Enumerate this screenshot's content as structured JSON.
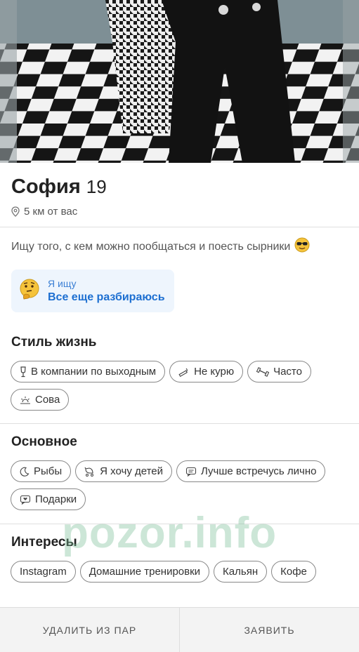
{
  "profile": {
    "name": "София",
    "age": "19",
    "distance": "5 км от вас",
    "bio": "Ищу того, с кем можно пообщаться и поесть сырники"
  },
  "seeking": {
    "label": "Я ищу",
    "value": "Все еще разбираюсь"
  },
  "lifestyle": {
    "title": "Стиль жизнь",
    "chips": [
      {
        "label": "В компании по выходным",
        "icon": "glass-icon"
      },
      {
        "label": "Не курю",
        "icon": "no-smoking-icon"
      },
      {
        "label": "Часто",
        "icon": "dumbbell-icon"
      },
      {
        "label": "Сова",
        "icon": "sunset-icon"
      }
    ]
  },
  "basics": {
    "title": "Основное",
    "chips": [
      {
        "label": "Рыбы",
        "icon": "moon-icon"
      },
      {
        "label": "Я хочу детей",
        "icon": "stroller-icon"
      },
      {
        "label": "Лучше встречусь лично",
        "icon": "chat-icon"
      },
      {
        "label": "Подарки",
        "icon": "gift-message-icon"
      }
    ]
  },
  "interests": {
    "title": "Интересы",
    "chips": [
      "Instagram",
      "Домашние тренировки",
      "Кальян",
      "Кофе"
    ]
  },
  "watermark": "pozor.info",
  "actions": {
    "remove": "УДАЛИТЬ ИЗ ПАР",
    "report": "ЗАЯВИТЬ"
  },
  "colors": {
    "accent": "#1d6fd1",
    "seeking_bg": "#eef5fd",
    "bottom_bar": "#f3f3f3"
  }
}
